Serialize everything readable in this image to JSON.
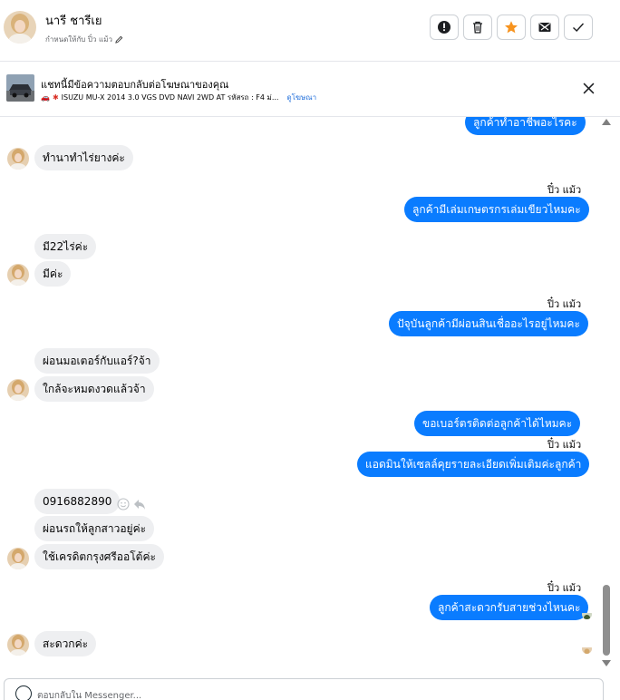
{
  "header": {
    "contact_name": "นารี ชารีเย",
    "assigned_text": "กำหนดให้กับ ปิ๋ว แม้ว",
    "actions": [
      {
        "name": "report-button",
        "icon": "alert-icon"
      },
      {
        "name": "delete-button",
        "icon": "trash-icon"
      },
      {
        "name": "star-button",
        "icon": "star-icon"
      },
      {
        "name": "spam-button",
        "icon": "mail-block-icon"
      },
      {
        "name": "done-button",
        "icon": "check-icon"
      }
    ],
    "colors": {
      "star": "#f7931e",
      "border": "#ccd0d5"
    }
  },
  "ad_banner": {
    "title": "แชทนี้มีข้อความตอบกลับต่อโฆษณาของคุณ",
    "subtitle": "ISUZU MU-X 2014 3.0 VGS DVD NAVI 2WD AT รหัสรถ : F4 ม่...",
    "link": "ดูโฆษณา"
  },
  "messages": {
    "m1": "ลูกค้าทำอาชีพอะไรคะ",
    "m2": "ทำนาทำไร่ยางค่ะ",
    "m3_sender": "ปิ๋ว แม้ว",
    "m3": "ลูกค้ามีเล่มเกษตรกรเล่มเขียวไหมคะ",
    "m4": "มี22ไร่ค่ะ",
    "m5": "มีค่ะ",
    "m6_sender": "ปิ๋ว แม้ว",
    "m6": "ปัจุบันลูกค้ามีผ่อนสินเชื่ออะไรอยู่ไหมคะ",
    "m7": "ผ่อนมอเตอร์กับแอร์?จ้า",
    "m8": "ใกล้จะหมดงวดแล้วจ้า",
    "m9": "ขอเบอร์ตรติดต่อลูกค้าได้ไหมคะ",
    "m10_sender": "ปิ๋ว แม้ว",
    "m10": "แอดมินให้เซลล์คุยรายละเอียดเพิ่มเติมค่ะลูกค้า",
    "m11": "0916882890",
    "m12": "ผ่อนรถให้ลูกสาวอยู่ค่ะ",
    "m13": "ใช้เครดิตกรุงศรีออโต้ค่ะ",
    "m14_sender": "ปิ๋ว แม้ว",
    "m14": "ลูกค้าสะดวกรับสายช่วงไหนคะ",
    "m15": "สะดวกค่ะ"
  },
  "reply": {
    "placeholder": "ตอบกลับใน Messenger..."
  },
  "colors": {
    "outgoing": "#0a7cff",
    "incoming": "#eeeff1"
  }
}
